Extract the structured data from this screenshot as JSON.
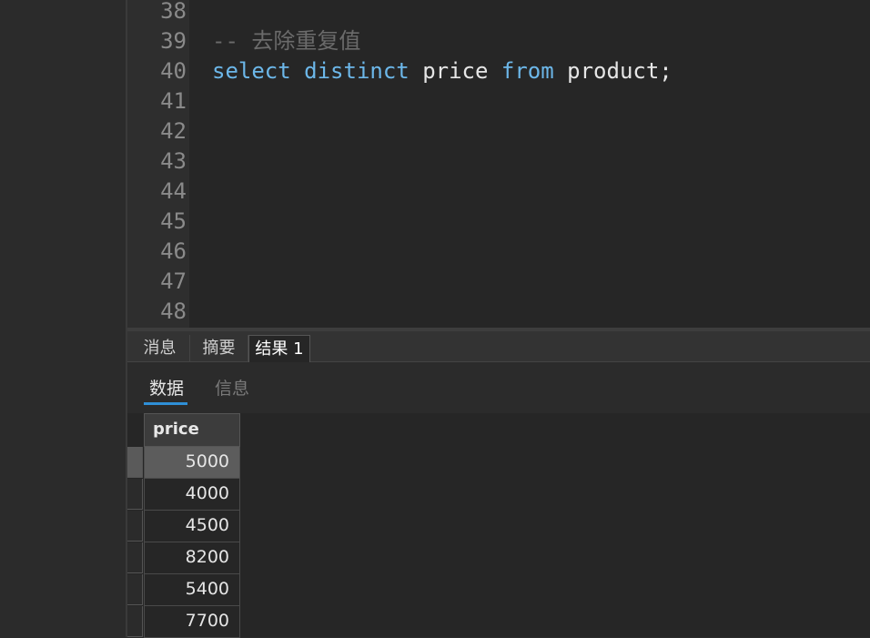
{
  "editor": {
    "line_numbers": [
      "38",
      "39",
      "40",
      "41",
      "42",
      "43",
      "44",
      "45",
      "46",
      "47",
      "48"
    ],
    "comment_line": "-- 去除重复值",
    "sql": {
      "kw_select": "select",
      "kw_distinct": "distinct",
      "col": "price",
      "kw_from": "from",
      "table": "product;"
    }
  },
  "results": {
    "tabs": [
      "消息",
      "摘要",
      "结果 1"
    ],
    "active_tab": "结果 1",
    "subtabs": [
      "数据",
      "信息"
    ],
    "active_subtab": "数据",
    "grid": {
      "columns": [
        "price"
      ],
      "rows": [
        "5000",
        "4000",
        "4500",
        "8200",
        "5400",
        "7700"
      ],
      "selected_row": 0
    }
  },
  "colors": {
    "keyword": "#6cb7e9",
    "comment": "#6b6b6b",
    "accent": "#2f8fd6"
  }
}
